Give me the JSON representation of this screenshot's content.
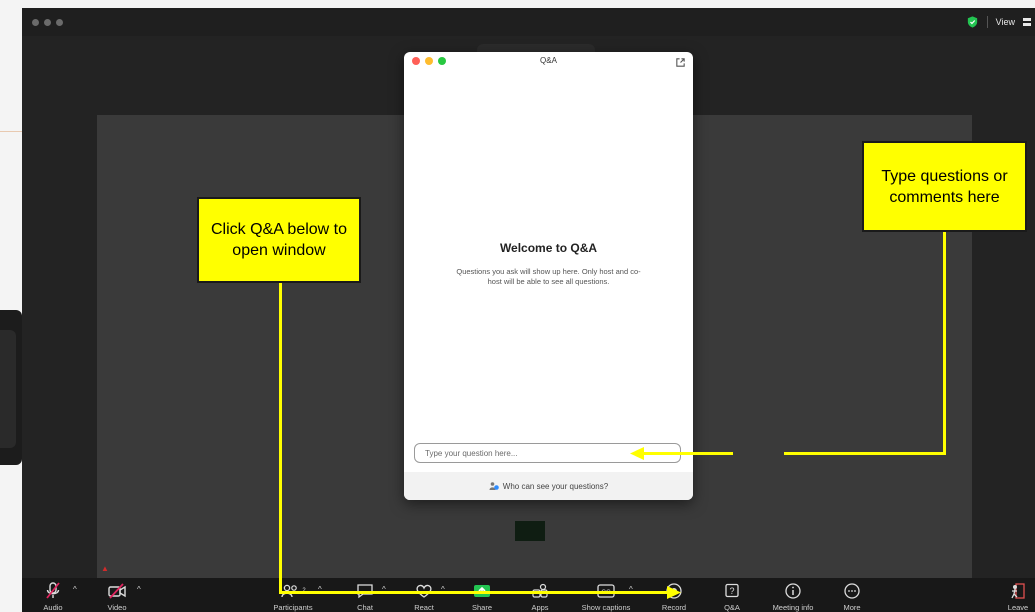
{
  "window": {
    "top_right_label": "View"
  },
  "qa": {
    "title": "Q&A",
    "welcome_title": "Welcome to Q&A",
    "welcome_body": "Questions you ask will show up here. Only host and co-host will be able to see all questions.",
    "input_placeholder": "Type your question here...",
    "footer": "Who can see your questions?"
  },
  "toolbar": {
    "audio": "Audio",
    "video": "Video",
    "participants": "Participants",
    "participants_count": "2",
    "chat": "Chat",
    "react": "React",
    "share": "Share",
    "apps": "Apps",
    "captions": "Show captions",
    "record": "Record",
    "qa": "Q&A",
    "meeting_info": "Meeting info",
    "more": "More",
    "leave": "Leave"
  },
  "annotations": {
    "left": "Click Q&A below to open window",
    "right": "Type questions or comments here"
  },
  "colors": {
    "annotation": "#ffff00",
    "share_green": "#23c552",
    "muted_red": "#e0245e"
  }
}
